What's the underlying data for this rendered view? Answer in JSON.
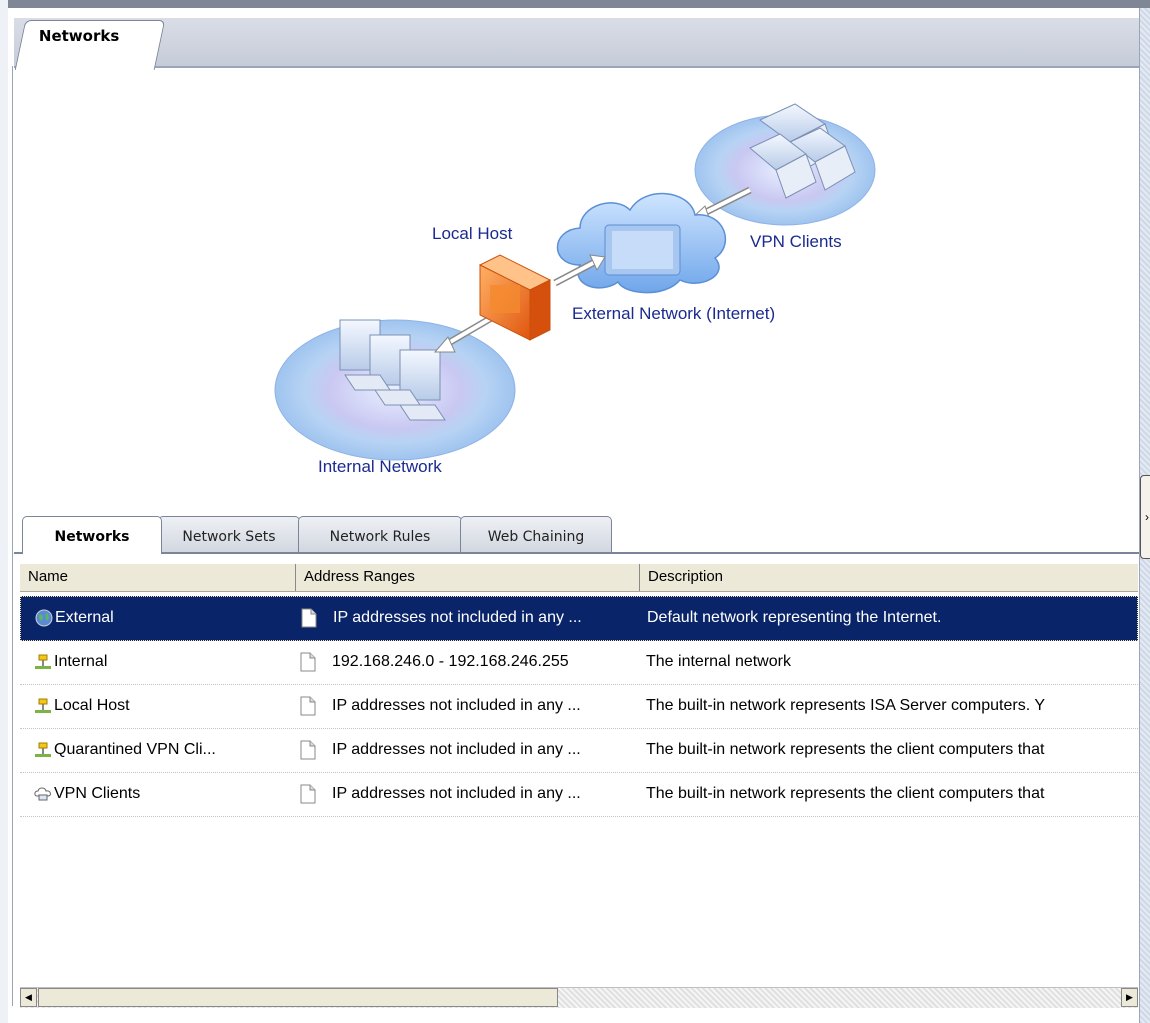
{
  "top_tab": {
    "label": "Networks"
  },
  "diagram": {
    "labels": {
      "local_host": "Local Host",
      "vpn_clients": "VPN Clients",
      "external": "External Network (Internet)",
      "internal": "Internal Network"
    }
  },
  "tabs": [
    {
      "label": "Networks",
      "active": true
    },
    {
      "label": "Network Sets",
      "active": false
    },
    {
      "label": "Network Rules",
      "active": false
    },
    {
      "label": "Web Chaining",
      "active": false
    }
  ],
  "columns": {
    "name": "Name",
    "address": "Address Ranges",
    "description": "Description"
  },
  "rows": [
    {
      "name": "External",
      "address": "IP addresses not included in any ...",
      "description": "Default network representing the Internet.",
      "icon": "globe-icon",
      "selected": true
    },
    {
      "name": "Internal",
      "address": "192.168.246.0 - 192.168.246.255",
      "description": "The internal network",
      "icon": "network-icon",
      "selected": false
    },
    {
      "name": "Local Host",
      "address": "IP addresses not included in any ...",
      "description": "The built-in network represents ISA Server computers. Y",
      "icon": "network-icon",
      "selected": false
    },
    {
      "name": "Quarantined VPN Cli...",
      "address": "IP addresses not included in any ...",
      "description": "The built-in network represents the client computers that",
      "icon": "network-icon",
      "selected": false
    },
    {
      "name": "VPN Clients",
      "address": "IP addresses not included in any ...",
      "description": "The built-in network represents the client computers that",
      "icon": "vpn-clients-icon",
      "selected": false
    }
  ],
  "colors": {
    "selection": "#0a246a",
    "diagram_label": "#1b2a8f",
    "firewall": "#f07a1e"
  }
}
